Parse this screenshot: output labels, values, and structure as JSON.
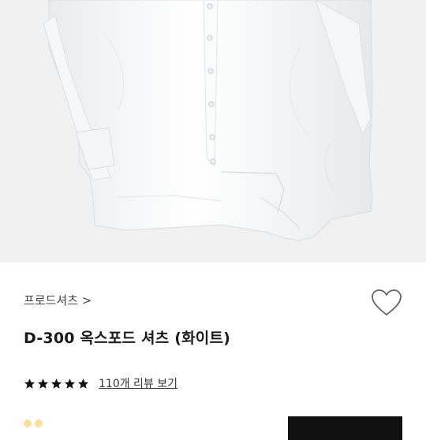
{
  "product": {
    "brand_link": "프로드셔츠 >",
    "title": "D-300 옥스포드 셔츠 (화이트)",
    "rating_stars": 5,
    "reviews_link": "110개 리뷰 보기"
  },
  "icons": {
    "wishlist": "heart-outline-icon",
    "star": "star-filled-icon"
  },
  "colors": {
    "hero_background": "#f1f1f1",
    "text_primary": "#1a1a1a",
    "stars": "#111111",
    "buy_button": "#111111"
  }
}
